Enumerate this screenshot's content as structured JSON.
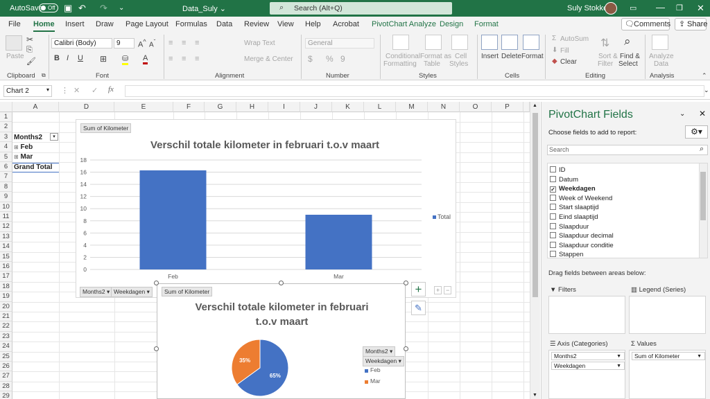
{
  "titlebar": {
    "autosave": "AutoSave",
    "toggle": "Off",
    "doc": "Data_Suly ⌄",
    "search": "Search (Alt+Q)",
    "user": "Suly Stokkel"
  },
  "tabs": [
    "File",
    "Home",
    "Insert",
    "Draw",
    "Page Layout",
    "Formulas",
    "Data",
    "Review",
    "View",
    "Help",
    "Acrobat",
    "PivotChart Analyze",
    "Design",
    "Format"
  ],
  "comments": "Comments",
  "share": "Share",
  "ribbon": {
    "paste": "Paste",
    "clipboard": "Clipboard",
    "font_name": "Calibri (Body)",
    "font_size": "9",
    "font": "Font",
    "wrap": "Wrap Text",
    "merge": "Merge & Center",
    "alignment": "Alignment",
    "number_format": "General",
    "number": "Number",
    "cond_fmt": "Conditional",
    "cond_fmt2": "Formatting",
    "fmt_table": "Format as",
    "fmt_table2": "Table",
    "cell_styles": "Cell",
    "cell_styles2": "Styles",
    "styles": "Styles",
    "insert": "Insert",
    "delete": "Delete",
    "format": "Format",
    "cells": "Cells",
    "autosum": "AutoSum",
    "fill": "Fill",
    "clear": "Clear",
    "sort": "Sort &",
    "sort2": "Filter",
    "find": "Find &",
    "find2": "Select",
    "editing": "Editing",
    "analyze": "Analyze",
    "analyze2": "Data",
    "analysis": "Analysis"
  },
  "namebox": "Chart 2",
  "columns": [
    "A",
    "D",
    "E",
    "F",
    "G",
    "H",
    "I",
    "J",
    "K",
    "L",
    "M",
    "N",
    "O",
    "P"
  ],
  "cells": {
    "r3": "Months2",
    "r4": "Feb",
    "r5": "Mar",
    "r6": "Grand Total"
  },
  "chart1": {
    "chip": "Sum of Kilometer",
    "legend": "Total",
    "months_btn": "Months2",
    "week_btn": "Weekdagen",
    "chart_data": {
      "type": "bar",
      "title": "Verschil totale kilometer in februari t.o.v maart",
      "categories": [
        "Feb",
        "Mar"
      ],
      "series": [
        {
          "name": "Total",
          "values": [
            16.3,
            9.0
          ]
        }
      ],
      "ylim": [
        0,
        18
      ],
      "yticks": [
        0,
        2,
        4,
        6,
        8,
        10,
        12,
        14,
        16,
        18
      ]
    }
  },
  "chart2": {
    "chip": "Sum of Kilometer",
    "title1": "Verschil totale kilometer in februari",
    "title2": "t.o.v maart",
    "months_btn": "Months2",
    "week_btn": "Weekdagen",
    "chart_data": {
      "type": "pie",
      "title": "Verschil totale kilometer in februari t.o.v maart",
      "categories": [
        "Feb",
        "Mar"
      ],
      "values": [
        65,
        35
      ],
      "labels": [
        "65%",
        "35%"
      ]
    }
  },
  "panel": {
    "title": "PivotChart Fields",
    "choose": "Choose fields to add to report:",
    "search": "Search",
    "fields": [
      {
        "label": "ID",
        "checked": false
      },
      {
        "label": "Datum",
        "checked": false
      },
      {
        "label": "Weekdagen",
        "checked": true
      },
      {
        "label": "Week of Weekend",
        "checked": false
      },
      {
        "label": "Start slaaptijd",
        "checked": false
      },
      {
        "label": "Eind slaaptijd",
        "checked": false
      },
      {
        "label": "Slaapduur",
        "checked": false
      },
      {
        "label": "Slaapduur decimal",
        "checked": false
      },
      {
        "label": "Slaapduur conditie",
        "checked": false
      },
      {
        "label": "Stappen",
        "checked": false
      }
    ],
    "drag": "Drag fields between areas below:",
    "filters": "Filters",
    "legend": "Legend (Series)",
    "axis": "Axis (Categories)",
    "values": "Values",
    "axis_items": [
      "Months2",
      "Weekdagen"
    ],
    "value_items": [
      "Sum of Kilometer"
    ]
  },
  "colors": {
    "brand": "#217346",
    "bar": "#4472c4",
    "pie_mar": "#ed7d31"
  }
}
